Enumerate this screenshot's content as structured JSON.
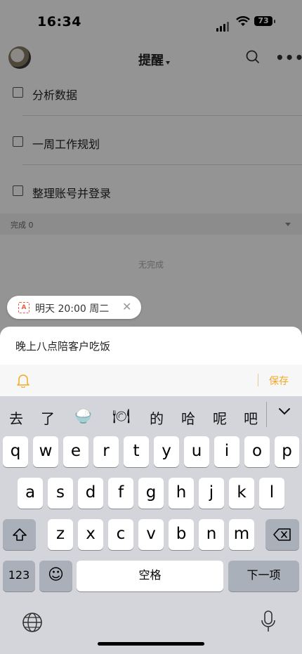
{
  "status": {
    "time": "16:34",
    "battery": "73"
  },
  "header": {
    "title": "提醒"
  },
  "tasks": [
    {
      "label": "分析数据"
    },
    {
      "label": "一周工作规划"
    },
    {
      "label": "整理账号并登录"
    }
  ],
  "completed": {
    "label": "完成 0",
    "empty_text": "无完成"
  },
  "chip": {
    "ai_badge": "A",
    "text": "明天 20:00 周二",
    "close": "✕"
  },
  "input": {
    "value": "晚上八点陪客户吃饭"
  },
  "toolbar": {
    "save_label": "保存"
  },
  "candidates": [
    "去",
    "了",
    "🍚",
    "🍽",
    "的",
    "哈",
    "呢",
    "吧"
  ],
  "keyboard": {
    "row1": [
      "q",
      "w",
      "e",
      "r",
      "t",
      "y",
      "u",
      "i",
      "o",
      "p"
    ],
    "row2": [
      "a",
      "s",
      "d",
      "f",
      "g",
      "h",
      "j",
      "k",
      "l"
    ],
    "row3": [
      "z",
      "x",
      "c",
      "v",
      "b",
      "n",
      "m"
    ],
    "numbers_label": "123",
    "emoji_label": "☺",
    "space_label": "空格",
    "next_label": "下一项"
  },
  "colors": {
    "accent": "#f5a623",
    "keyboard_bg": "#d3d5da",
    "ai_badge": "#e8604b"
  }
}
